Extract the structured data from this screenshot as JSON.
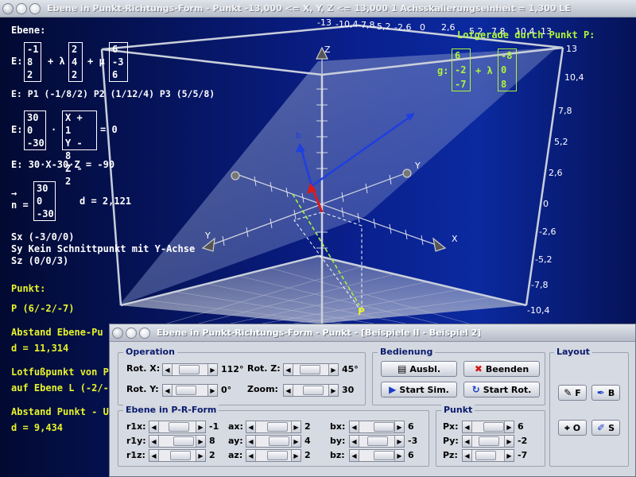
{
  "window": {
    "title": "Ebene in Punkt-Richtungs-Form - Punkt   -13,000 <= X, Y, Z <= 13,000    1 Achsskalierungseinheit = 1,300 LE"
  },
  "overlay": {
    "ebene_label": "Ebene:",
    "e_prefix": "E:",
    "vec_p": [
      "-1",
      "8",
      "2"
    ],
    "plus_lambda": "+ λ",
    "vec_a": [
      "2",
      "4",
      "2"
    ],
    "plus_mu": "+ μ",
    "vec_b": [
      "6",
      "-3",
      "6"
    ],
    "points_line": "E: P1 (-1/8/2)    P2 (1/12/4)    P3 (5/5/8)",
    "normal_form_prefix": "E:",
    "normal_vec": [
      "30",
      "0",
      "-30"
    ],
    "dot": "·",
    "diff_vec": [
      "X + 1",
      "Y - 8",
      "Z - 2"
    ],
    "eq_zero": "= 0",
    "coord_form": "E: 30·X-30·Z = -90",
    "n_arrow": "→",
    "n_label": "n =",
    "n_vec": [
      "30",
      "0",
      "-30"
    ],
    "d_text": "d = 2,121",
    "sx": "Sx (-3/0/0)",
    "sy": "Sy Kein Schnittpunkt mit Y-Achse",
    "sz": "Sz (0/0/3)",
    "punkt_label": "Punkt:",
    "punkt_value": "P (6/-2/-7)",
    "abstand_ebene": "Abstand Ebene-Pu",
    "abstand_ebene_val": "d = 11,314",
    "lotfuss": "Lotfußpunkt von P",
    "lotfuss_val": "auf Ebene L (-2/-2",
    "abstand_punkt": "Abstand Punkt - U",
    "abstand_punkt_val": "d = 9,434",
    "lotgerade_title": "Lotgerade durch Punkt P:",
    "g_label": "g:",
    "g_vec1": [
      "6",
      "-2",
      "-7"
    ],
    "g_plus_lambda": "+ λ",
    "g_vec2": [
      "-8",
      "0",
      "8"
    ]
  },
  "axes": {
    "top_ticks": [
      "-13",
      "-10,4",
      "-7,8",
      "-5,2",
      "-2,6",
      "0",
      "2,6",
      "5,2",
      "7,8",
      "10,4",
      "13"
    ],
    "right_ticks": [
      "13",
      "10,4",
      "7,8",
      "5,2",
      "2,6",
      "0",
      "-2,6",
      "-5,2",
      "-7,8",
      "-10,4"
    ],
    "labels": {
      "x": "X",
      "y1": "Y",
      "y2": "Y",
      "z": "Z",
      "p": "P",
      "a": "a",
      "b": "b"
    }
  },
  "dialog": {
    "title": "Ebene in Punkt-Richtungs-Form - Punkt - [Beispiele II - Beispiel 2]",
    "operation": {
      "title": "Operation",
      "rotx_label": "Rot. X:",
      "rotx_val": "112°",
      "roty_label": "Rot. Y:",
      "roty_val": "0°",
      "rotz_label": "Rot. Z:",
      "rotz_val": "45°",
      "zoom_label": "Zoom:",
      "zoom_val": "30"
    },
    "bedienung": {
      "title": "Bedienung",
      "ausbl": "Ausbl.",
      "beenden": "Beenden",
      "start_sim": "Start Sim.",
      "start_rot": "Start Rot."
    },
    "layout": {
      "title": "Layout",
      "f": "F",
      "b": "B",
      "o": "O",
      "s": "S"
    },
    "ebene": {
      "title": "Ebene in P-R-Form",
      "r1x_label": "r1x:",
      "r1x_val": "-1",
      "r1y_label": "r1y:",
      "r1y_val": "8",
      "r1z_label": "r1z:",
      "r1z_val": "2",
      "ax_label": "ax:",
      "ax_val": "2",
      "ay_label": "ay:",
      "ay_val": "4",
      "az_label": "az:",
      "az_val": "2",
      "bx_label": "bx:",
      "bx_val": "6",
      "by_label": "by:",
      "by_val": "-3",
      "bz_label": "bz:",
      "bz_val": "6"
    },
    "punkt": {
      "title": "Punkt",
      "px_label": "Px:",
      "px_val": "6",
      "py_label": "Py:",
      "py_val": "-2",
      "pz_label": "Pz:",
      "pz_val": "-7"
    }
  }
}
